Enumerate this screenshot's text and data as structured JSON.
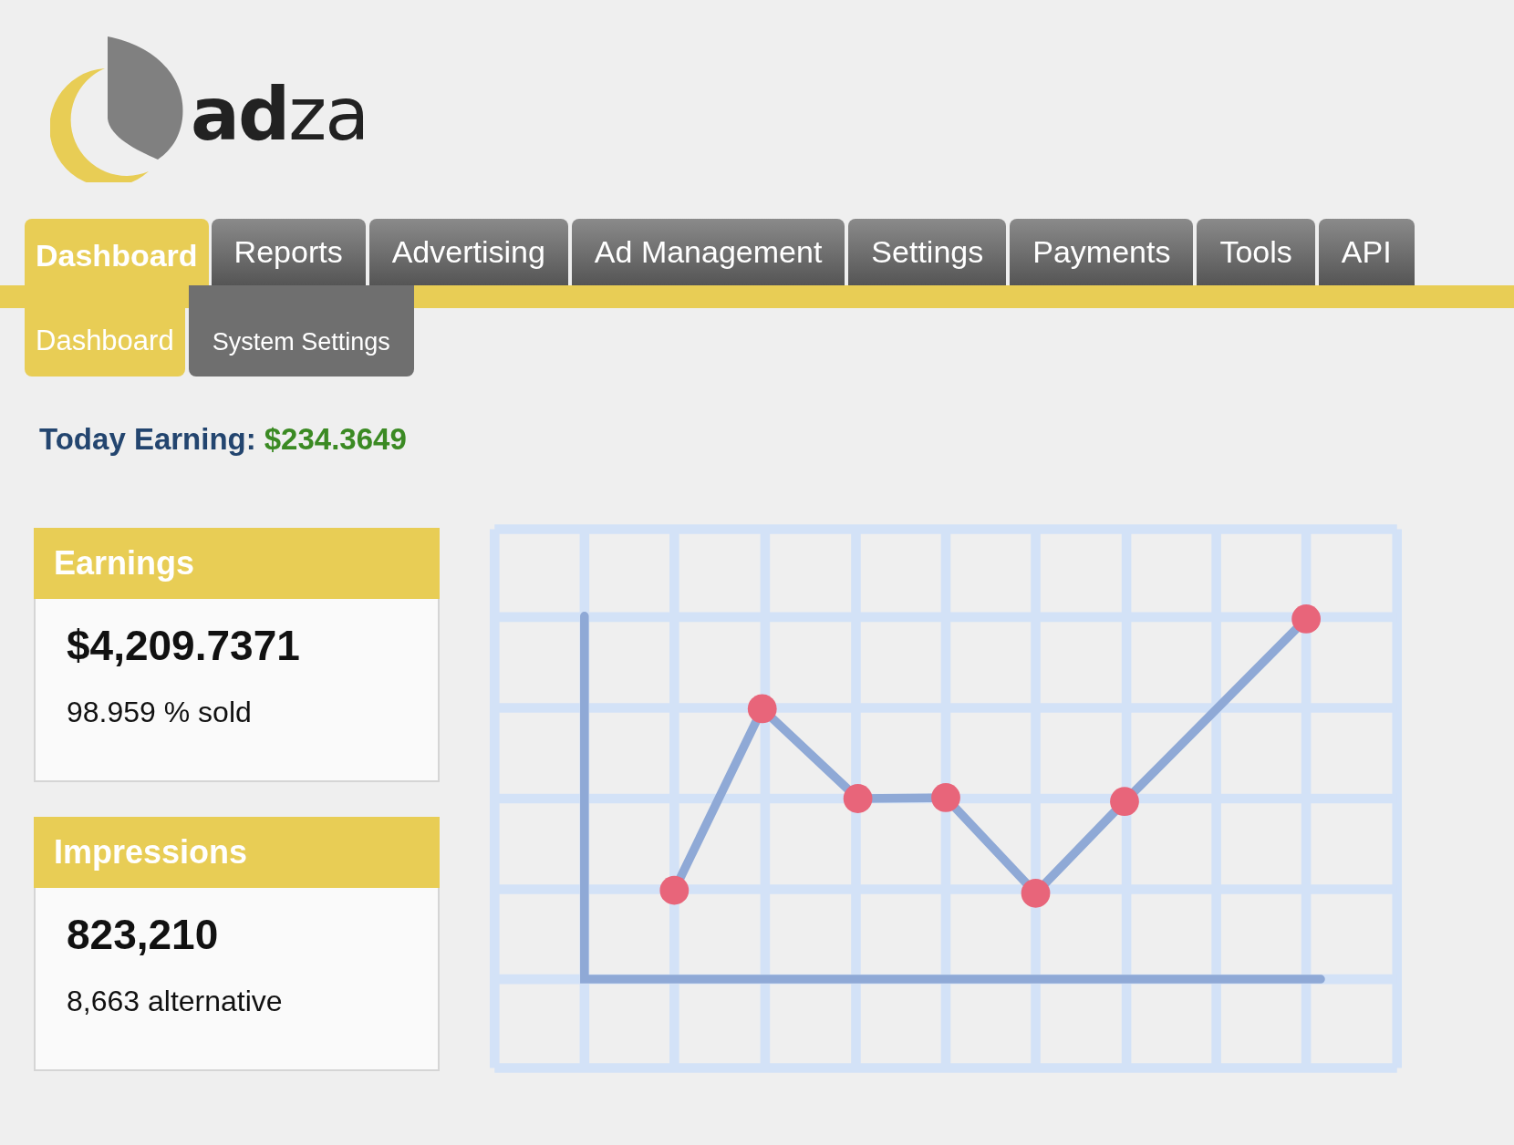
{
  "logo": {
    "bold_part": "ad",
    "light_part": "za"
  },
  "tabs": [
    {
      "label": "Dashboard",
      "selected": true
    },
    {
      "label": "Reports",
      "selected": false
    },
    {
      "label": "Advertising",
      "selected": false
    },
    {
      "label": "Ad Management",
      "selected": false
    },
    {
      "label": "Settings",
      "selected": false
    },
    {
      "label": "Payments",
      "selected": false
    },
    {
      "label": "Tools",
      "selected": false
    },
    {
      "label": "API",
      "selected": false
    }
  ],
  "subtabs": [
    {
      "label": "Dashboard",
      "selected": true
    },
    {
      "label": "System Settings",
      "selected": false
    }
  ],
  "today_earning": {
    "label": "Today Earning:",
    "value": "$234.3649"
  },
  "cards": [
    {
      "title": "Earnings",
      "value": "$4,209.7371",
      "note": "98.959 % sold"
    },
    {
      "title": "Impressions",
      "value": "823,210",
      "note": "8,663 alternative"
    }
  ]
}
